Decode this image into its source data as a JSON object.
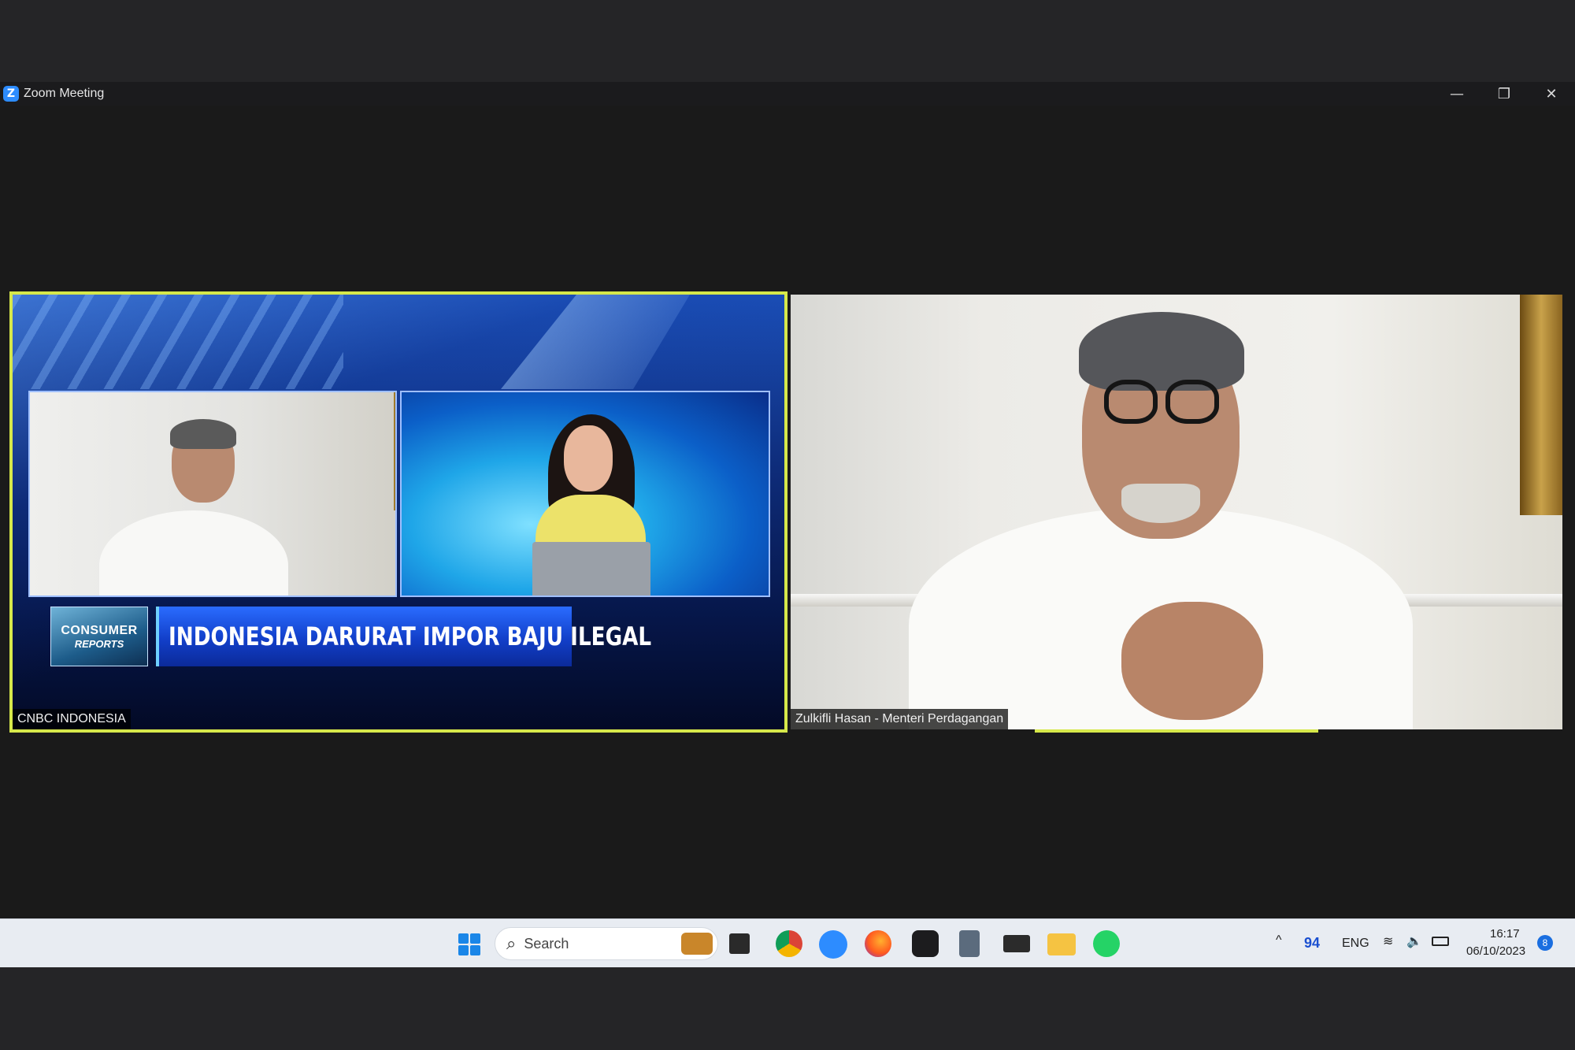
{
  "window": {
    "title": "Zoom Meeting",
    "minimize_glyph": "—",
    "restore_glyph": "❐",
    "close_glyph": "✕",
    "logo_letter": "Z"
  },
  "participants": [
    {
      "name": "CNBC INDONESIA",
      "active_speaker": true,
      "broadcast": {
        "segment_l1": "CONSUMER",
        "segment_l2": "REPORTS",
        "headline": "INDONESIA DARURAT IMPOR BAJU ILEGAL"
      }
    },
    {
      "name": "Zulkifli Hasan - Menteri Perdagangan",
      "active_speaker": false
    }
  ],
  "colors": {
    "active_border": "#d6e84a",
    "zoom_blue": "#2d8cff"
  },
  "taskbar": {
    "search_placeholder": "Search",
    "apps": [
      "widgets-briefcase-icon",
      "task-view-icon",
      "chrome-icon",
      "zoom-icon",
      "firefox-icon",
      "speedometer-icon",
      "calculator-icon",
      "terminal-icon",
      "file-explorer-icon",
      "whatsapp-icon"
    ],
    "tray": {
      "chevron": "^",
      "network_value": "94",
      "language": "ENG",
      "time": "16:17",
      "date": "06/10/2023",
      "notification_count": "8"
    }
  }
}
